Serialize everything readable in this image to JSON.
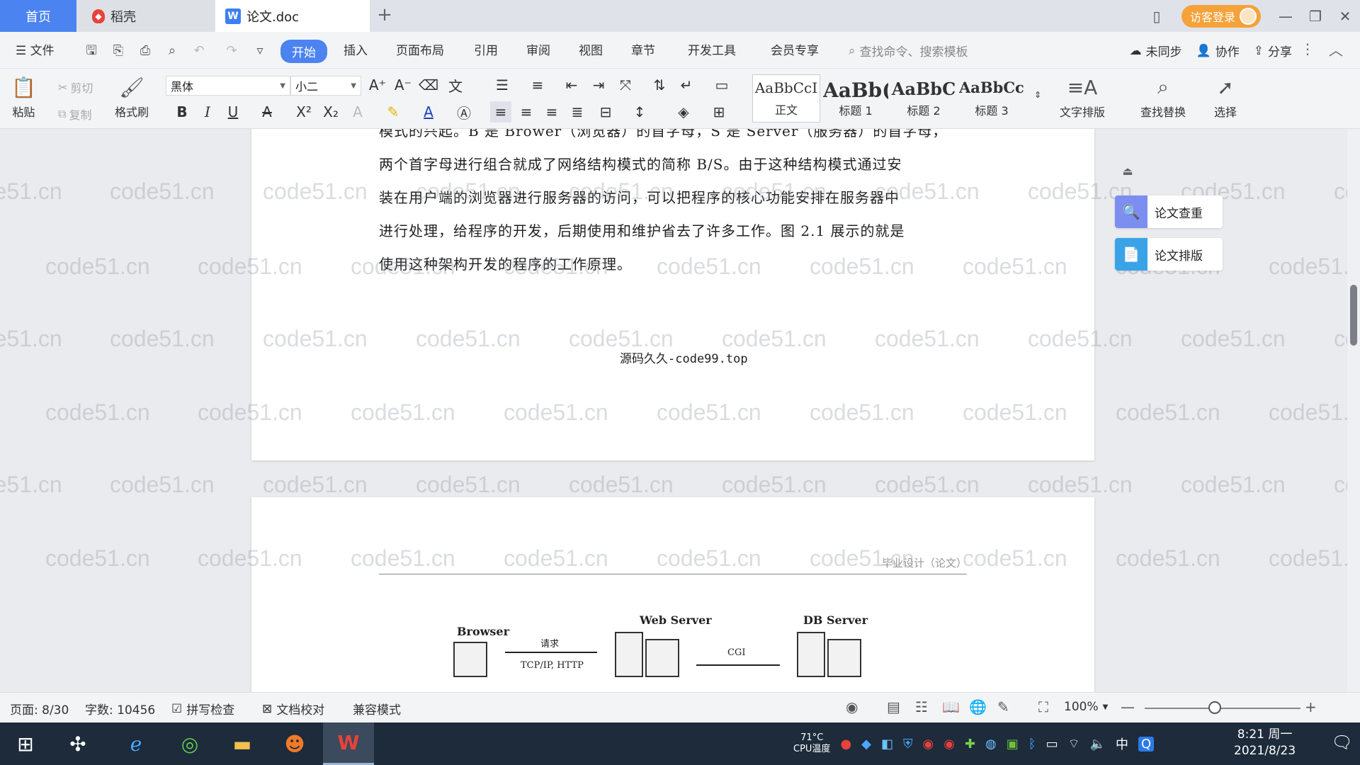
{
  "tabs": {
    "home": "首页",
    "docer": "稻壳",
    "doc": "论文.doc"
  },
  "window": {
    "guest_login": "访客登录"
  },
  "menu": {
    "file": "文件",
    "items": [
      "开始",
      "插入",
      "页面布局",
      "引用",
      "审阅",
      "视图",
      "章节",
      "开发工具",
      "会员专享"
    ],
    "search_placeholder": "查找命令、搜索模板",
    "sync": "未同步",
    "collab": "协作",
    "share": "分享"
  },
  "toolbar": {
    "paste": "粘贴",
    "cut": "剪切",
    "copy": "复制",
    "format_painter": "格式刷",
    "font_name": "黑体",
    "font_size": "小二",
    "styles": [
      {
        "sample": "AaBbCcI",
        "name": "正文"
      },
      {
        "sample": "AaBb(",
        "name": "标题 1"
      },
      {
        "sample": "AaBbC",
        "name": "标题 2"
      },
      {
        "sample": "AaBbCcI",
        "name": "标题 3"
      }
    ],
    "text_layout": "文字排版",
    "find_replace": "查找替换",
    "select": "选择"
  },
  "document": {
    "paragraph_lines": [
      "模式的兴起。B 是 Brower（浏览器）的首字母，S 是 Server（服务器）的首字母，",
      "两个首字母进行组合就成了网络结构模式的简称 B/S。由于这种结构模式通过安",
      "装在用户端的浏览器进行服务器的访问，可以把程序的核心功能安排在服务器中",
      "进行处理，给程序的开发，后期使用和维护省去了许多工作。图 2.1 展示的就是",
      "使用这种架构开发的程序的工作原理。"
    ],
    "page_footer": "源码久久-code99.top",
    "page2_header": "毕业设计（论文）",
    "diagram": {
      "browser": "Browser",
      "web_server": "Web Server",
      "db_server": "DB Server",
      "request": "请求",
      "protocol": "TCP/IP, HTTP",
      "cgi": "CGI"
    },
    "watermark": "code51.cn"
  },
  "side_panel": {
    "check": "论文查重",
    "layout": "论文排版"
  },
  "status": {
    "page": "页面: 8/30",
    "words": "字数: 10456",
    "spell_check": "拼写检查",
    "proofread": "文档校对",
    "compat_mode": "兼容模式",
    "zoom": "100%"
  },
  "taskbar": {
    "cpu_temp": "71°C",
    "cpu_label": "CPU温度",
    "ime": "中",
    "time": "8:21 周一",
    "date": "2021/8/23"
  }
}
